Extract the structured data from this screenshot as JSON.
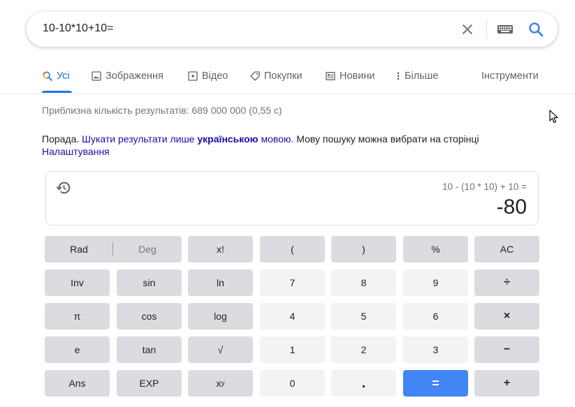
{
  "search": {
    "query": "10-10*10+10=",
    "icons": [
      "close-icon",
      "keyboard-icon",
      "search-icon"
    ]
  },
  "tabs": [
    {
      "label": "Усі",
      "icon": "search-icon",
      "active": true
    },
    {
      "label": "Зображення",
      "icon": "image-icon"
    },
    {
      "label": "Відео",
      "icon": "video-icon"
    },
    {
      "label": "Покупки",
      "icon": "tag-icon"
    },
    {
      "label": "Новини",
      "icon": "news-icon"
    },
    {
      "label": "Більше",
      "icon": "more-vert-icon"
    }
  ],
  "tools_label": "Інструменти",
  "result_stats": "Приблизна кількість результатів: 689 000 000 (0,55 с)",
  "tip": {
    "prefix": "Порада.",
    "link1": "Шукати результати лише",
    "lang": "українською",
    "link2": "мовою",
    "mid": ". Мову пошуку можна вибрати на сторінці",
    "settings": "Налаштування"
  },
  "calculator": {
    "expression": "10 - (10 * 10) + 10 =",
    "result": "-80",
    "keys": {
      "rad": "Rad",
      "deg": "Deg",
      "fact": "x!",
      "lparen": "(",
      "rparen": ")",
      "percent": "%",
      "ac": "AC",
      "inv": "Inv",
      "sin": "sin",
      "ln": "ln",
      "k7": "7",
      "k8": "8",
      "k9": "9",
      "divide": "÷",
      "pi": "π",
      "cos": "cos",
      "log": "log",
      "k4": "4",
      "k5": "5",
      "k6": "6",
      "multiply": "×",
      "e": "e",
      "tan": "tan",
      "sqrt": "√",
      "k1": "1",
      "k2": "2",
      "k3": "3",
      "minus": "−",
      "ans": "Ans",
      "exp": "EXP",
      "pow_base": "x",
      "pow_exp": "y",
      "k0": "0",
      "dot": ".",
      "equals": "=",
      "plus": "+"
    }
  },
  "colors": {
    "accent": "#1a73e8",
    "link": "#1a0dab",
    "equals_key": "#4285f4",
    "fn_key": "#dadce0",
    "num_key": "#f1f3f4"
  }
}
